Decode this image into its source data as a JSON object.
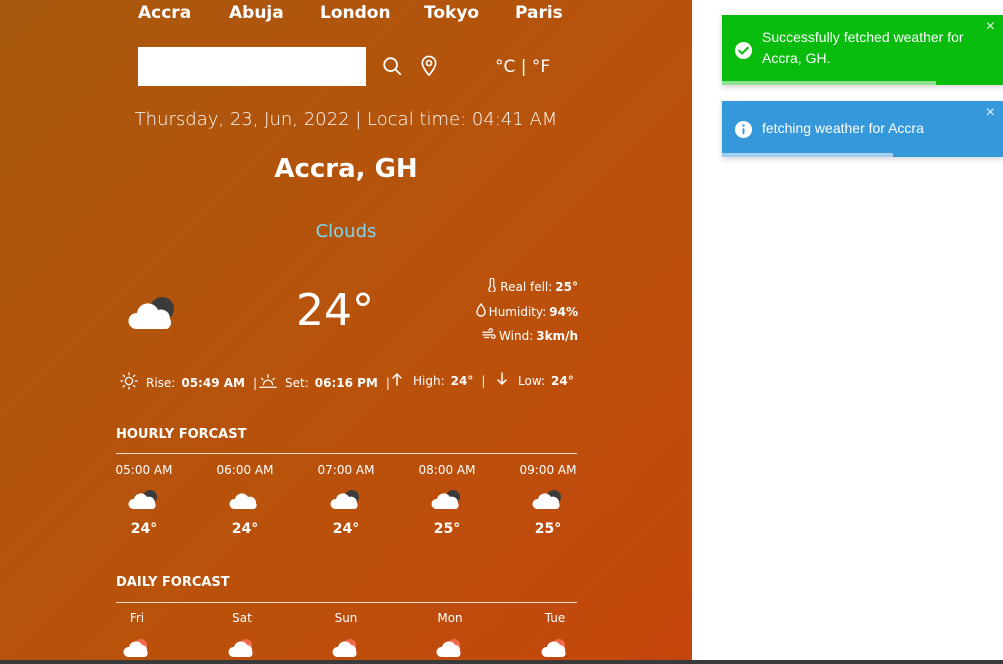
{
  "cities": [
    "Accra",
    "Abuja",
    "London",
    "Tokyo",
    "Paris"
  ],
  "search": {
    "value": "",
    "placeholder": ""
  },
  "units": {
    "celsius": "°C",
    "separator": " | ",
    "fahrenheit": "°F"
  },
  "datetime": "Thursday, 23, Jun, 2022 | Local time: 04:41 AM",
  "location": "Accra, GH",
  "condition": "Clouds",
  "current": {
    "temperature": "24°",
    "icon": "cloud-moon-icon",
    "details": [
      {
        "icon": "thermometer-icon",
        "label": "Real fell:",
        "value": "25°"
      },
      {
        "icon": "droplet-icon",
        "label": "Humidity:",
        "value": "94%"
      },
      {
        "icon": "wind-icon",
        "label": "Wind:",
        "value": "3km/h"
      }
    ]
  },
  "sun": {
    "rise_label": "Rise:",
    "rise_value": "05:49 AM",
    "set_label": "Set:",
    "set_value": "06:16 PM",
    "high_label": "High:",
    "high_value": "24°",
    "low_label": "Low:",
    "low_value": "24°",
    "separator": "|"
  },
  "hourly": {
    "title": "HOURLY FORCAST",
    "items": [
      {
        "label": "05:00 AM",
        "temp": "24°",
        "icon": "cloud-moon-icon"
      },
      {
        "label": "06:00 AM",
        "temp": "24°",
        "icon": "cloud-icon"
      },
      {
        "label": "07:00 AM",
        "temp": "24°",
        "icon": "cloud-moon-icon"
      },
      {
        "label": "08:00 AM",
        "temp": "25°",
        "icon": "cloud-moon-icon"
      },
      {
        "label": "09:00 AM",
        "temp": "25°",
        "icon": "cloud-moon-icon"
      }
    ]
  },
  "daily": {
    "title": "DAILY FORCAST",
    "items": [
      {
        "label": "Fri",
        "icon": "cloud-sun-rain-icon"
      },
      {
        "label": "Sat",
        "icon": "cloud-sun-rain-icon"
      },
      {
        "label": "Sun",
        "icon": "cloud-sun-rain-icon"
      },
      {
        "label": "Mon",
        "icon": "cloud-sun-rain-icon"
      },
      {
        "label": "Tue",
        "icon": "cloud-sun-rain-icon"
      }
    ]
  },
  "toasts": [
    {
      "type": "success",
      "message": "Successfully fetched weather for Accra, GH.",
      "color": "#07bc0c",
      "close": "×",
      "progress": 0.76
    },
    {
      "type": "info",
      "message": "fetching weather for Accra",
      "color": "#3498db",
      "close": "×",
      "progress": 0.61
    }
  ],
  "colors": {
    "condition": "#7fd6ea",
    "background_start": "#a8580f",
    "background_end": "#c4460c"
  }
}
